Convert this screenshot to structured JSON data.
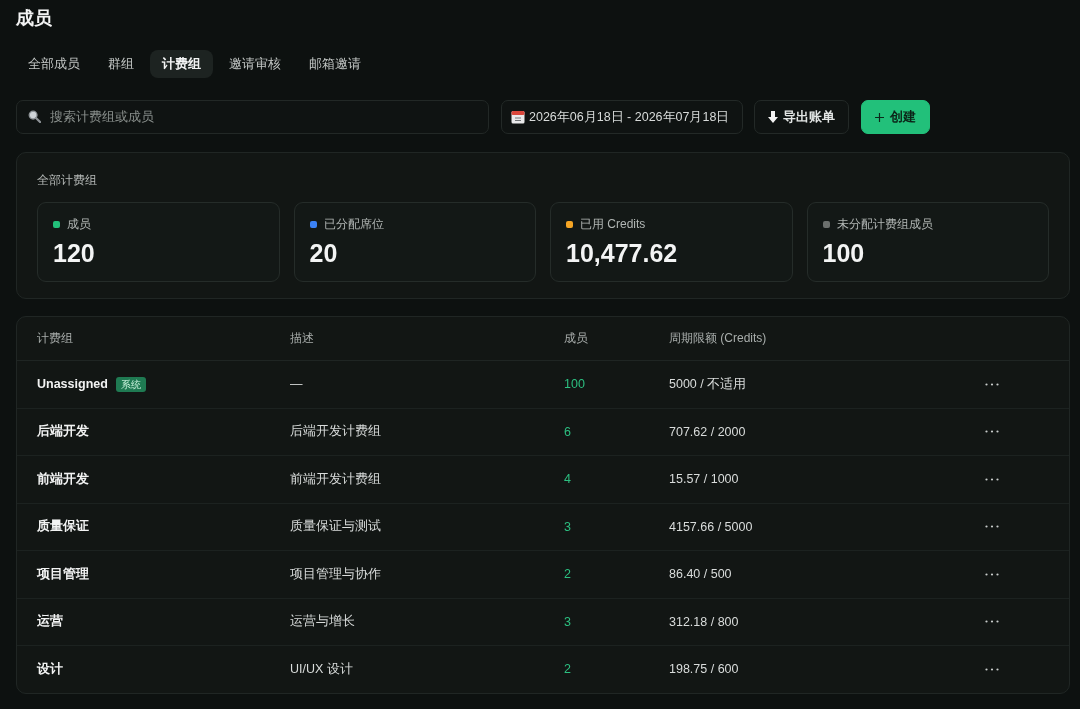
{
  "page": {
    "title": "成员"
  },
  "tabs": [
    {
      "label": "全部成员",
      "selected": false
    },
    {
      "label": "群组",
      "selected": false
    },
    {
      "label": "计费组",
      "selected": true
    },
    {
      "label": "邀请审核",
      "selected": false
    },
    {
      "label": "邮箱邀请",
      "selected": false
    }
  ],
  "toolbar": {
    "search": {
      "placeholder": "搜索计费组或成员"
    },
    "date_range": "2026年06月18日 - 2026年07月18日",
    "export_button": "导出账单",
    "create_button": "创建"
  },
  "summary": {
    "title": "全部计费组",
    "stats": [
      {
        "label": "成员",
        "value": "120",
        "color": "#22c07a"
      },
      {
        "label": "已分配席位",
        "value": "20",
        "color": "#3b82f6"
      },
      {
        "label": "已用 Credits",
        "value": "10,477.62",
        "color": "#f5a524"
      },
      {
        "label": "未分配计费组成员",
        "value": "100",
        "color": "#6b6f6d"
      }
    ]
  },
  "table": {
    "columns": [
      "计费组",
      "描述",
      "成员",
      "周期限额 (Credits)"
    ],
    "rows": [
      {
        "name": "Unassigned",
        "badge": "系统",
        "description": "—",
        "members": "100",
        "limit": "5000 / 不适用"
      },
      {
        "name": "后端开发",
        "description": "后端开发计费组",
        "members": "6",
        "limit": "707.62 / 2000"
      },
      {
        "name": "前端开发",
        "description": "前端开发计费组",
        "members": "4",
        "limit": "15.57 / 1000"
      },
      {
        "name": "质量保证",
        "description": "质量保证与测试",
        "members": "3",
        "limit": "4157.66 / 5000"
      },
      {
        "name": "项目管理",
        "description": "项目管理与协作",
        "members": "2",
        "limit": "86.40 / 500"
      },
      {
        "name": "运营",
        "description": "运营与增长",
        "members": "3",
        "limit": "312.18 / 800"
      },
      {
        "name": "设计",
        "description": "UI/UX 设计",
        "members": "2",
        "limit": "198.75 / 600"
      }
    ]
  }
}
